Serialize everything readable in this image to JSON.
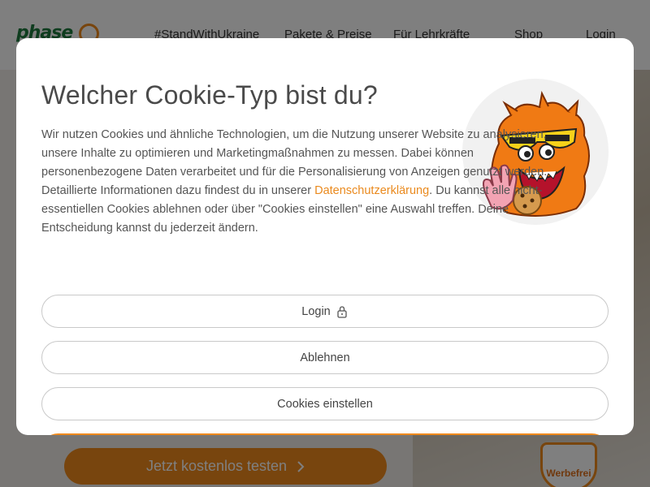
{
  "background": {
    "logo": "phase",
    "nav": [
      {
        "label": "#StandWithUkraine"
      },
      {
        "label": "Pakete & Preise"
      },
      {
        "label": "Für Lehrkräfte"
      },
      {
        "label": "Shop"
      },
      {
        "label": "Login"
      }
    ],
    "cta_label": "Jetzt kostenlos testen",
    "badge_label": "Werbefrei"
  },
  "modal": {
    "title": "Welcher Cookie-Typ bist du?",
    "text_before_link": "Wir nutzen Cookies und ähnliche Technologien, um die Nutzung unserer Website zu analysieren, unsere Inhalte zu optimieren und Marketingmaßnahmen zu messen. Dabei können personenbezogene Daten verarbeitet und für die Personalisierung von Anzeigen genutzt werden. Detaillierte Informationen dazu findest du in unserer ",
    "link_label": "Datenschutzerklärung",
    "text_after_link": ". Du kannst alle nicht-essentiellen Cookies ablehnen oder über \"Cookies einstellen\" eine Auswahl treffen. Deine Entscheidung kannst du jederzeit ändern.",
    "buttons": {
      "login": "Login",
      "decline": "Ablehnen",
      "settings": "Cookies einstellen"
    },
    "icons": {
      "login": "lock-icon",
      "mascot": "cookie-monster-mascot"
    }
  },
  "colors": {
    "accent": "#f08a1c",
    "brand_green": "#1e7a3f",
    "link": "#ea8a1e"
  }
}
